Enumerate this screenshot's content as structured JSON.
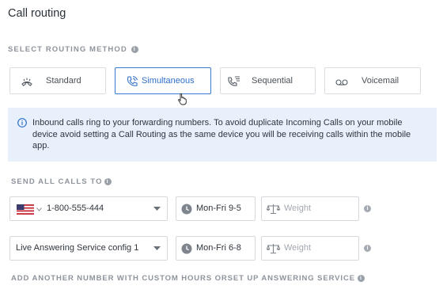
{
  "page": {
    "title": "Call routing"
  },
  "routing_method": {
    "label": "SELECT ROUTING METHOD",
    "options": [
      {
        "label": "Standard",
        "icon": "phone-handset-icon",
        "selected": false
      },
      {
        "label": "Simultaneous",
        "icon": "phone-ring-icon",
        "selected": true
      },
      {
        "label": "Sequential",
        "icon": "phone-list-icon",
        "selected": false
      },
      {
        "label": "Voicemail",
        "icon": "voicemail-icon",
        "selected": false
      }
    ]
  },
  "notice": {
    "icon": "info-circle-icon",
    "text": "Inbound calls ring to your forwarding numbers. To avoid duplicate Incoming Calls on your mobile device avoid setting a Call Routing as the same device you will be receiving calls within the mobile app."
  },
  "send_calls": {
    "label": "SEND ALL CALLS TO",
    "rows": [
      {
        "target": "1-800-555-444",
        "flag": "us-flag-icon",
        "hours": "Mon-Fri 9-5",
        "weight_placeholder": "Weight"
      },
      {
        "target": "Live Answering Service config 1",
        "hours": "Mon-Fri 6-8",
        "weight_placeholder": "Weight"
      }
    ]
  },
  "add_another": {
    "label": "ADD ANOTHER NUMBER WITH CUSTOM HOURS ORSET UP ANSWERING SERVICE"
  },
  "colors": {
    "accent": "#3a7bd5",
    "notice_bg": "#e8f1fb",
    "border": "#d9dde2"
  }
}
